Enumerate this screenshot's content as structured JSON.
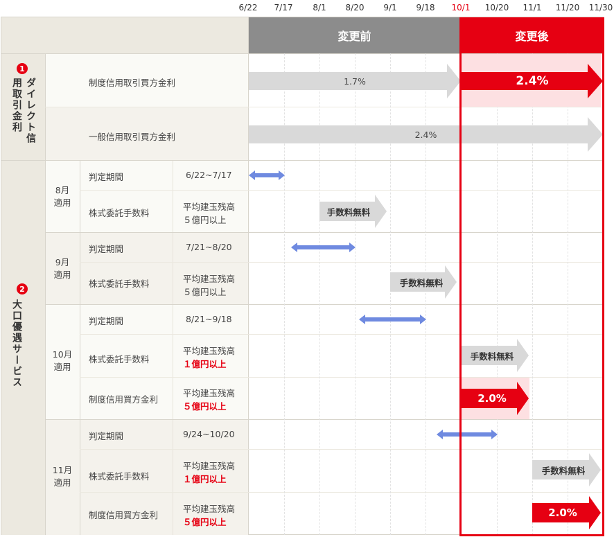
{
  "timeline": {
    "dates": [
      "6/22",
      "7/17",
      "8/1",
      "8/20",
      "9/1",
      "9/18",
      "10/1",
      "10/20",
      "11/1",
      "11/20",
      "11/30"
    ],
    "highlight_date": "10/1"
  },
  "header": {
    "before": "変更前",
    "after": "変更後"
  },
  "section1": {
    "badge": "1",
    "title": "ダイレクト信用取引金利",
    "rows": [
      {
        "label": "制度信用取引買方金利",
        "before": "1.7%",
        "after": "2.4%"
      },
      {
        "label": "一般信用取引買方金利",
        "value": "2.4%"
      }
    ]
  },
  "section2": {
    "badge": "2",
    "title": "大口優遇サービス",
    "groups": [
      {
        "month": "8月\n適用",
        "period_label": "判定期間",
        "period": "6/22~7/17",
        "fee_label": "株式委託手数料",
        "fee_cond_1": "平均建玉残高",
        "fee_cond_2": "５億円以上",
        "free_label": "手数料無料"
      },
      {
        "month": "9月\n適用",
        "period_label": "判定期間",
        "period": "7/21~8/20",
        "fee_label": "株式委託手数料",
        "fee_cond_1": "平均建玉残高",
        "fee_cond_2": "５億円以上",
        "free_label": "手数料無料"
      },
      {
        "month": "10月\n適用",
        "period_label": "判定期間",
        "period": "8/21~9/18",
        "fee_label": "株式委託手数料",
        "fee_cond_1": "平均建玉残高",
        "fee_cond_2": "１億円以上",
        "free_label": "手数料無料",
        "rate_label": "制度信用買方金利",
        "rate_cond_1": "平均建玉残高",
        "rate_cond_2": "５億円以上",
        "rate_value": "2.0%"
      },
      {
        "month": "11月\n適用",
        "period_label": "判定期間",
        "period": "9/24~10/20",
        "fee_label": "株式委託手数料",
        "fee_cond_1": "平均建玉残高",
        "fee_cond_2": "１億円以上",
        "free_label": "手数料無料",
        "rate_label": "制度信用買方金利",
        "rate_cond_1": "平均建玉残高",
        "rate_cond_2": "５億円以上",
        "rate_value": "2.0%"
      }
    ]
  },
  "colors": {
    "accent": "#e60012",
    "arrow_gray": "#d9d9d9",
    "double_arrow": "#6f8ae0",
    "after_bg": "#fde0e2"
  }
}
